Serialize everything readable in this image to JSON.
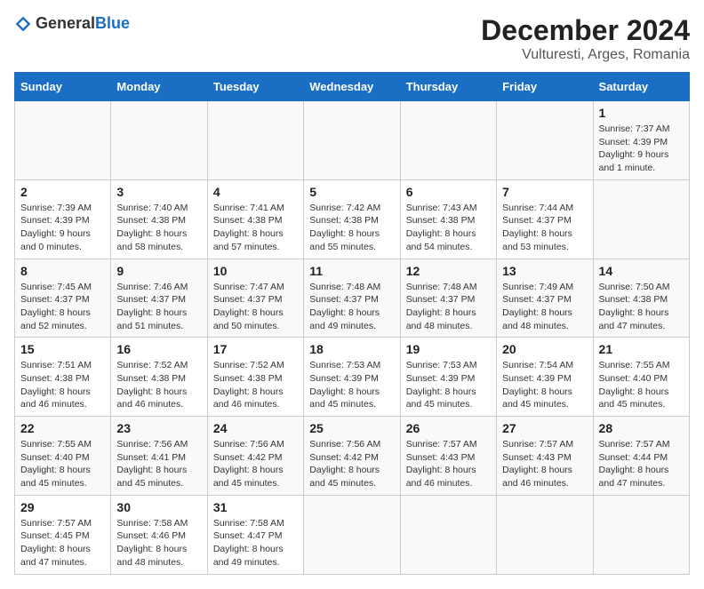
{
  "header": {
    "logo_general": "General",
    "logo_blue": "Blue",
    "title": "December 2024",
    "subtitle": "Vulturesti, Arges, Romania"
  },
  "calendar": {
    "days_of_week": [
      "Sunday",
      "Monday",
      "Tuesday",
      "Wednesday",
      "Thursday",
      "Friday",
      "Saturday"
    ],
    "weeks": [
      [
        null,
        null,
        null,
        null,
        null,
        null,
        {
          "day": "1",
          "sunrise": "Sunrise: 7:37 AM",
          "sunset": "Sunset: 4:39 PM",
          "daylight": "Daylight: 9 hours and 1 minute."
        }
      ],
      [
        {
          "day": "2",
          "sunrise": "Sunrise: 7:39 AM",
          "sunset": "Sunset: 4:39 PM",
          "daylight": "Daylight: 9 hours and 0 minutes."
        },
        {
          "day": "3",
          "sunrise": "Sunrise: 7:40 AM",
          "sunset": "Sunset: 4:38 PM",
          "daylight": "Daylight: 8 hours and 58 minutes."
        },
        {
          "day": "4",
          "sunrise": "Sunrise: 7:41 AM",
          "sunset": "Sunset: 4:38 PM",
          "daylight": "Daylight: 8 hours and 57 minutes."
        },
        {
          "day": "5",
          "sunrise": "Sunrise: 7:42 AM",
          "sunset": "Sunset: 4:38 PM",
          "daylight": "Daylight: 8 hours and 55 minutes."
        },
        {
          "day": "6",
          "sunrise": "Sunrise: 7:43 AM",
          "sunset": "Sunset: 4:38 PM",
          "daylight": "Daylight: 8 hours and 54 minutes."
        },
        {
          "day": "7",
          "sunrise": "Sunrise: 7:44 AM",
          "sunset": "Sunset: 4:37 PM",
          "daylight": "Daylight: 8 hours and 53 minutes."
        },
        null
      ],
      [
        {
          "day": "8",
          "sunrise": "Sunrise: 7:45 AM",
          "sunset": "Sunset: 4:37 PM",
          "daylight": "Daylight: 8 hours and 52 minutes."
        },
        {
          "day": "9",
          "sunrise": "Sunrise: 7:46 AM",
          "sunset": "Sunset: 4:37 PM",
          "daylight": "Daylight: 8 hours and 51 minutes."
        },
        {
          "day": "10",
          "sunrise": "Sunrise: 7:47 AM",
          "sunset": "Sunset: 4:37 PM",
          "daylight": "Daylight: 8 hours and 50 minutes."
        },
        {
          "day": "11",
          "sunrise": "Sunrise: 7:48 AM",
          "sunset": "Sunset: 4:37 PM",
          "daylight": "Daylight: 8 hours and 49 minutes."
        },
        {
          "day": "12",
          "sunrise": "Sunrise: 7:48 AM",
          "sunset": "Sunset: 4:37 PM",
          "daylight": "Daylight: 8 hours and 48 minutes."
        },
        {
          "day": "13",
          "sunrise": "Sunrise: 7:49 AM",
          "sunset": "Sunset: 4:37 PM",
          "daylight": "Daylight: 8 hours and 48 minutes."
        },
        {
          "day": "14",
          "sunrise": "Sunrise: 7:50 AM",
          "sunset": "Sunset: 4:38 PM",
          "daylight": "Daylight: 8 hours and 47 minutes."
        }
      ],
      [
        {
          "day": "15",
          "sunrise": "Sunrise: 7:51 AM",
          "sunset": "Sunset: 4:38 PM",
          "daylight": "Daylight: 8 hours and 46 minutes."
        },
        {
          "day": "16",
          "sunrise": "Sunrise: 7:52 AM",
          "sunset": "Sunset: 4:38 PM",
          "daylight": "Daylight: 8 hours and 46 minutes."
        },
        {
          "day": "17",
          "sunrise": "Sunrise: 7:52 AM",
          "sunset": "Sunset: 4:38 PM",
          "daylight": "Daylight: 8 hours and 46 minutes."
        },
        {
          "day": "18",
          "sunrise": "Sunrise: 7:53 AM",
          "sunset": "Sunset: 4:39 PM",
          "daylight": "Daylight: 8 hours and 45 minutes."
        },
        {
          "day": "19",
          "sunrise": "Sunrise: 7:53 AM",
          "sunset": "Sunset: 4:39 PM",
          "daylight": "Daylight: 8 hours and 45 minutes."
        },
        {
          "day": "20",
          "sunrise": "Sunrise: 7:54 AM",
          "sunset": "Sunset: 4:39 PM",
          "daylight": "Daylight: 8 hours and 45 minutes."
        },
        {
          "day": "21",
          "sunrise": "Sunrise: 7:55 AM",
          "sunset": "Sunset: 4:40 PM",
          "daylight": "Daylight: 8 hours and 45 minutes."
        }
      ],
      [
        {
          "day": "22",
          "sunrise": "Sunrise: 7:55 AM",
          "sunset": "Sunset: 4:40 PM",
          "daylight": "Daylight: 8 hours and 45 minutes."
        },
        {
          "day": "23",
          "sunrise": "Sunrise: 7:56 AM",
          "sunset": "Sunset: 4:41 PM",
          "daylight": "Daylight: 8 hours and 45 minutes."
        },
        {
          "day": "24",
          "sunrise": "Sunrise: 7:56 AM",
          "sunset": "Sunset: 4:42 PM",
          "daylight": "Daylight: 8 hours and 45 minutes."
        },
        {
          "day": "25",
          "sunrise": "Sunrise: 7:56 AM",
          "sunset": "Sunset: 4:42 PM",
          "daylight": "Daylight: 8 hours and 45 minutes."
        },
        {
          "day": "26",
          "sunrise": "Sunrise: 7:57 AM",
          "sunset": "Sunset: 4:43 PM",
          "daylight": "Daylight: 8 hours and 46 minutes."
        },
        {
          "day": "27",
          "sunrise": "Sunrise: 7:57 AM",
          "sunset": "Sunset: 4:43 PM",
          "daylight": "Daylight: 8 hours and 46 minutes."
        },
        {
          "day": "28",
          "sunrise": "Sunrise: 7:57 AM",
          "sunset": "Sunset: 4:44 PM",
          "daylight": "Daylight: 8 hours and 47 minutes."
        }
      ],
      [
        {
          "day": "29",
          "sunrise": "Sunrise: 7:57 AM",
          "sunset": "Sunset: 4:45 PM",
          "daylight": "Daylight: 8 hours and 47 minutes."
        },
        {
          "day": "30",
          "sunrise": "Sunrise: 7:58 AM",
          "sunset": "Sunset: 4:46 PM",
          "daylight": "Daylight: 8 hours and 48 minutes."
        },
        {
          "day": "31",
          "sunrise": "Sunrise: 7:58 AM",
          "sunset": "Sunset: 4:47 PM",
          "daylight": "Daylight: 8 hours and 49 minutes."
        },
        null,
        null,
        null,
        null
      ]
    ]
  }
}
